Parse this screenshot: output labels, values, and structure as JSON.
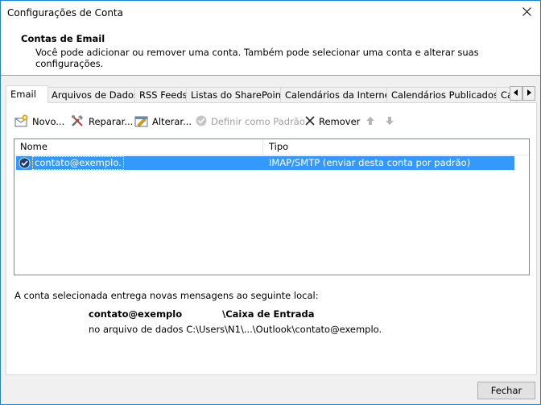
{
  "window": {
    "title": "Configurações de Conta"
  },
  "header": {
    "title": "Contas de Email",
    "description": "Você pode adicionar ou remover uma conta. Também pode selecionar uma conta e alterar suas configurações."
  },
  "tabs": [
    {
      "label": "Email",
      "active": true
    },
    {
      "label": "Arquivos de Dados"
    },
    {
      "label": "RSS Feeds"
    },
    {
      "label": "Listas do SharePoint"
    },
    {
      "label": "Calendários da Internet"
    },
    {
      "label": "Calendários Publicados"
    },
    {
      "label": "Ca"
    }
  ],
  "toolbar": {
    "new": "Novo...",
    "repair": "Reparar...",
    "change": "Alterar...",
    "set_default": "Definir como Padrão",
    "remove": "Remover"
  },
  "list": {
    "col_name": "Nome",
    "col_type": "Tipo",
    "rows": [
      {
        "name": "contato@exemplo.",
        "type": "IMAP/SMTP (enviar desta conta por padrão)"
      }
    ]
  },
  "delivery": {
    "label": "A conta selecionada entrega novas mensagens ao seguinte local:",
    "account": "contato@exemplo",
    "folder": "\\Caixa de Entrada",
    "datafile": "no arquivo de dados C:\\Users\\N1\\...\\Outlook\\contato@exemplo."
  },
  "footer": {
    "close": "Fechar"
  },
  "colors": {
    "selection": "#3399ff",
    "accent": "#1883d7"
  }
}
